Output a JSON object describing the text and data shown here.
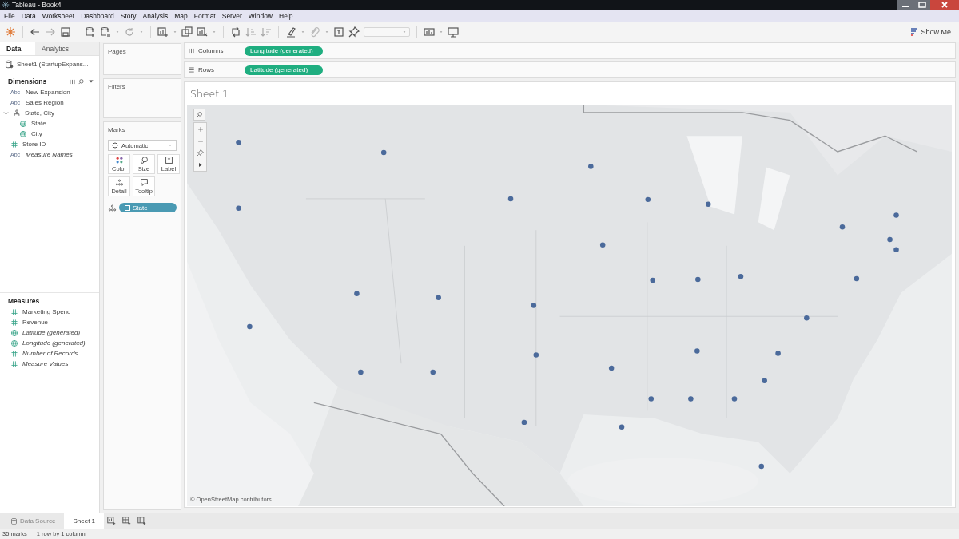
{
  "window": {
    "title": "Tableau - Book4"
  },
  "menu": [
    "File",
    "Data",
    "Worksheet",
    "Dashboard",
    "Story",
    "Analysis",
    "Map",
    "Format",
    "Server",
    "Window",
    "Help"
  ],
  "toolbar": {
    "show_me": "Show Me"
  },
  "data_pane": {
    "tabs": [
      {
        "label": "Data",
        "selected": true
      },
      {
        "label": "Analytics",
        "selected": false
      }
    ],
    "data_source": "Sheet1 (StartupExpans...",
    "dimensions": {
      "title": "Dimensions",
      "items": [
        {
          "label": "New Expansion",
          "kind": "text",
          "type_label": "Abc",
          "italic": false
        },
        {
          "label": "Sales Region",
          "kind": "text",
          "type_label": "Abc",
          "italic": false
        },
        {
          "label": "State, City",
          "kind": "hierarchy",
          "italic": false,
          "expanded": true,
          "children": [
            {
              "label": "State",
              "kind": "geo",
              "italic": false
            },
            {
              "label": "City",
              "kind": "geo",
              "italic": false
            }
          ]
        },
        {
          "label": "Store ID",
          "kind": "number",
          "italic": false
        },
        {
          "label": "Measure Names",
          "kind": "text",
          "type_label": "Abc",
          "italic": true
        }
      ]
    },
    "measures": {
      "title": "Measures",
      "items": [
        {
          "label": "Marketing Spend",
          "kind": "number",
          "italic": false
        },
        {
          "label": "Revenue",
          "kind": "number",
          "italic": false
        },
        {
          "label": "Latitude (generated)",
          "kind": "geo",
          "italic": true
        },
        {
          "label": "Longitude (generated)",
          "kind": "geo",
          "italic": true
        },
        {
          "label": "Number of Records",
          "kind": "number",
          "italic": true
        },
        {
          "label": "Measure Values",
          "kind": "number",
          "italic": true
        }
      ]
    }
  },
  "cards": {
    "pages": "Pages",
    "filters": "Filters",
    "marks": {
      "title": "Marks",
      "mark_type": "Automatic",
      "buttons": [
        {
          "label": "Color",
          "kind": "color"
        },
        {
          "label": "Size",
          "kind": "size"
        },
        {
          "label": "Label",
          "kind": "label"
        },
        {
          "label": "Detail",
          "kind": "detail"
        },
        {
          "label": "Tooltip",
          "kind": "tooltip"
        }
      ],
      "pills": [
        {
          "label": "State",
          "kind": "detail"
        }
      ]
    }
  },
  "shelves": [
    {
      "label": "Columns",
      "kind": "columns",
      "pills": [
        "Longitude (generated)"
      ]
    },
    {
      "label": "Rows",
      "kind": "rows",
      "pills": [
        "Latitude (generated)"
      ]
    }
  ],
  "view": {
    "title": "Sheet 1",
    "attribution": "© OpenStreetMap contributors"
  },
  "sheet_tabs": [
    {
      "label": "Data Source",
      "kind": "source",
      "selected": false
    },
    {
      "label": "Sheet 1",
      "kind": "sheet",
      "selected": true
    }
  ],
  "status_bar": [
    "35 marks",
    "1 row by 1 column"
  ]
}
